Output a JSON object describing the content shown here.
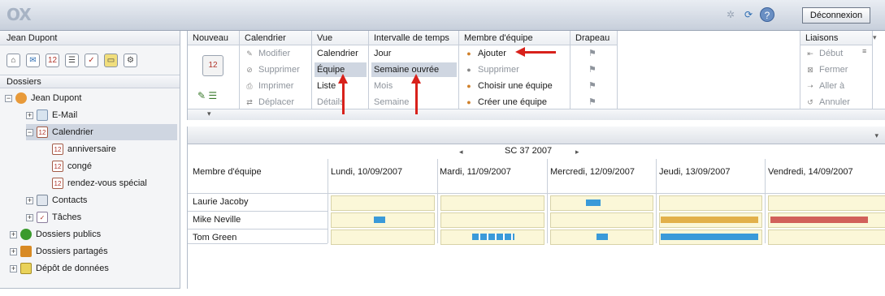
{
  "app": {
    "logo": "OX",
    "logout_label": "Déconnexion",
    "icons": [
      "spinner-icon",
      "refresh-icon",
      "help-icon"
    ]
  },
  "left": {
    "user_header": "Jean Dupont",
    "app_icons": [
      "portal-icon",
      "mail-icon",
      "calendar-icon",
      "contacts-icon",
      "tasks-icon",
      "infostore-icon",
      "settings-icon"
    ],
    "folders_header": "Dossiers",
    "tree": [
      {
        "label": "Jean Dupont",
        "icon": "user-icon",
        "expander": "−"
      },
      {
        "label": "E-Mail",
        "icon": "mail-icon",
        "expander": "+"
      },
      {
        "label": "Calendrier",
        "icon": "calendar-icon",
        "expander": "−"
      },
      {
        "label": "anniversaire",
        "icon": "calendar-icon"
      },
      {
        "label": "congé",
        "icon": "calendar-icon"
      },
      {
        "label": "rendez-vous spécial",
        "icon": "calendar-icon"
      },
      {
        "label": "Contacts",
        "icon": "contacts-icon",
        "expander": "+"
      },
      {
        "label": "Tâches",
        "icon": "tasks-icon",
        "expander": "+"
      },
      {
        "label": "Dossiers publics",
        "icon": "public-folders-icon",
        "expander": "+"
      },
      {
        "label": "Dossiers partagés",
        "icon": "shared-folders-icon",
        "expander": "+"
      },
      {
        "label": "Dépôt de données",
        "icon": "infostore-icon",
        "expander": "+"
      }
    ]
  },
  "ribbon": {
    "nouveau": {
      "header": "Nouveau"
    },
    "calendrier": {
      "header": "Calendrier",
      "items": [
        "Modifier",
        "Supprimer",
        "Imprimer",
        "Déplacer"
      ]
    },
    "vue": {
      "header": "Vue",
      "items": [
        "Calendrier",
        "Équipe",
        "Liste",
        "Détails"
      ]
    },
    "intervalle": {
      "header": "Intervalle de temps",
      "items": [
        "Jour",
        "Semaine ouvrée",
        "Mois",
        "Semaine"
      ]
    },
    "membre": {
      "header": "Membre d'équipe",
      "items": [
        "Ajouter",
        "Supprimer",
        "Choisir une équipe",
        "Créer une équipe"
      ]
    },
    "drapeau": {
      "header": "Drapeau"
    },
    "liaisons": {
      "header": "Liaisons",
      "items": [
        "Début",
        "Fermer",
        "Aller à",
        "Annuler"
      ]
    }
  },
  "calendar": {
    "week_label": "SC 37 2007",
    "member_column": "Membre d'équipe",
    "days": [
      "Lundi, 10/09/2007",
      "Mardi, 11/09/2007",
      "Mercredi, 12/09/2007",
      "Jeudi, 13/09/2007",
      "Vendredi, 14/09/2007"
    ],
    "members": [
      "Laurie Jacoby",
      "Mike Neville",
      "Tom Green"
    ],
    "colors": {
      "blue": "#3a9ad9",
      "orange": "#e2b04a",
      "red": "#d1605a"
    }
  }
}
